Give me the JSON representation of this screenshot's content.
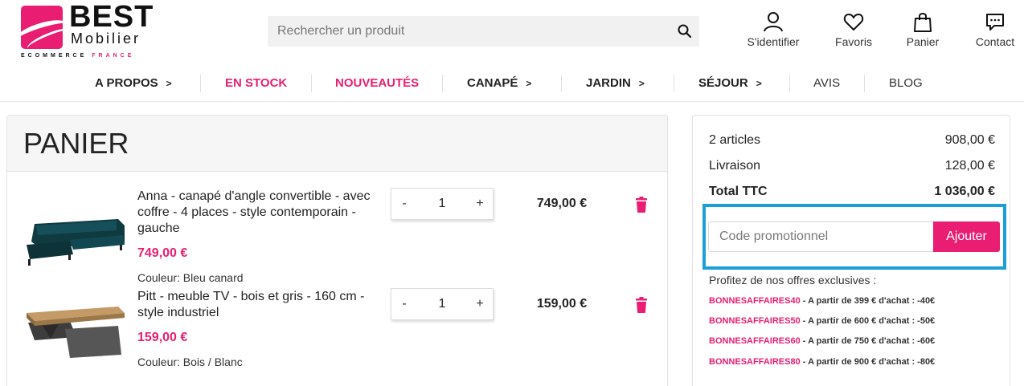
{
  "brand": {
    "name_top": "BEST",
    "name_bottom": "Mobilier",
    "tagline_a": "ECOMMERCE",
    "tagline_b": "FRANCE",
    "accent": "#e91e73"
  },
  "search": {
    "placeholder": "Rechercher un produit",
    "icon": "search-icon"
  },
  "header_links": [
    {
      "label": "S'identifier",
      "icon": "user-icon"
    },
    {
      "label": "Favoris",
      "icon": "heart-icon"
    },
    {
      "label": "Panier",
      "icon": "bag-icon"
    },
    {
      "label": "Contact",
      "icon": "chat-icon"
    }
  ],
  "nav": [
    {
      "label": "A PROPOS"
    },
    {
      "label": "EN STOCK"
    },
    {
      "label": "NOUVEAUTÉS"
    },
    {
      "label": "CANAPÉ"
    },
    {
      "label": "JARDIN"
    },
    {
      "label": "SÉJOUR"
    },
    {
      "label": "AVIS"
    },
    {
      "label": "BLOG"
    }
  ],
  "cart": {
    "title": "PANIER",
    "items": [
      {
        "name": "Anna - canapé d'angle convertible - avec coffre - 4 places - style contemporain - gauche",
        "unit_price": "749,00 €",
        "color": "Couleur: Bleu canard",
        "quantity": "1",
        "total": "749,00 €"
      },
      {
        "name": "Pitt - meuble TV - bois et gris - 160 cm - style industriel",
        "unit_price": "159,00 €",
        "color": "Couleur: Bois / Blanc",
        "quantity": "1",
        "total": "159,00 €"
      }
    ],
    "minus": "-",
    "plus": "+"
  },
  "summary": {
    "articles_label": "2 articles",
    "articles_value": "908,00 €",
    "shipping_label": "Livraison",
    "shipping_value": "128,00 €",
    "total_label": "Total TTC",
    "total_value": "1 036,00 €",
    "promo_placeholder": "Code promotionnel",
    "promo_button": "Ajouter",
    "offers_title": "Profitez de nos offres exclusives :",
    "offers": [
      {
        "code": "BONNESAFFAIRES40",
        "text": " - A partir de 399 € d'achat : -40€"
      },
      {
        "code": "BONNESAFFAIRES50",
        "text": " - A partir de 600 € d'achat : -50€"
      },
      {
        "code": "BONNESAFFAIRES60",
        "text": " - A partir de 750 € d'achat : -60€"
      },
      {
        "code": "BONNESAFFAIRES80",
        "text": " - A partir de 900 € d'achat : -80€"
      }
    ]
  }
}
